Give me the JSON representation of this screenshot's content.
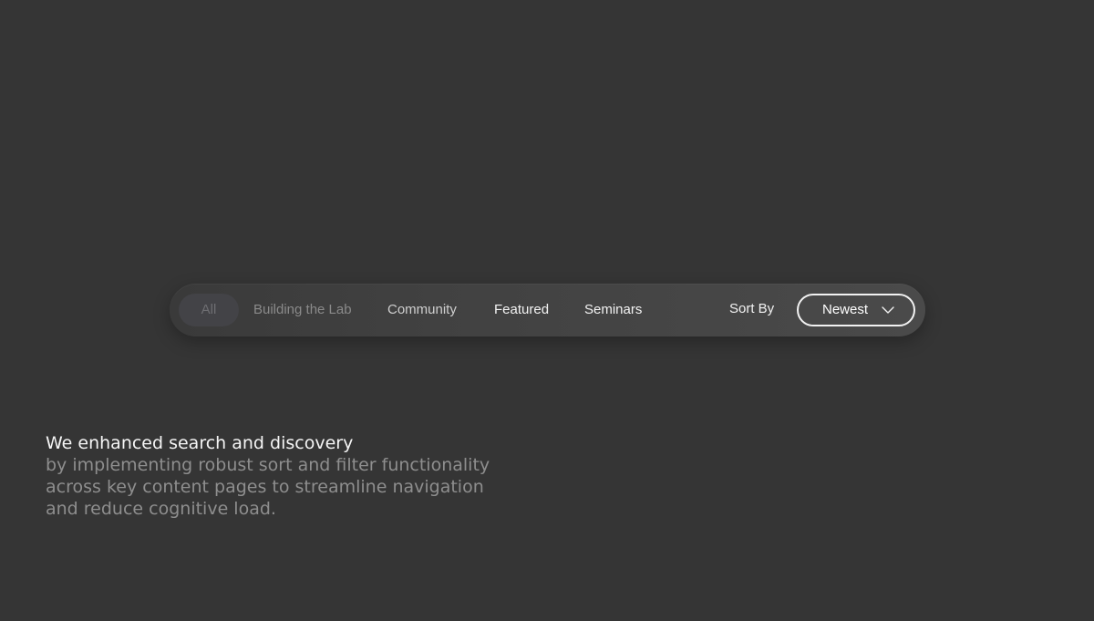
{
  "filter_bar": {
    "tabs": [
      {
        "label": "All",
        "state": "selected"
      },
      {
        "label": "Building the Lab"
      },
      {
        "label": "Community"
      },
      {
        "label": "Featured"
      },
      {
        "label": "Seminars"
      }
    ],
    "sort": {
      "label": "Sort By",
      "selected": "Newest",
      "icon": "chevron-down-icon"
    }
  },
  "caption": {
    "headline": "We enhanced search and discovery",
    "body": "by implementing robust sort and filter functionality\nacross key content pages to streamline navigation\nand reduce cognitive load."
  },
  "colors": {
    "background": "#353535",
    "bar": "#444444",
    "text_primary": "#f2f2f2",
    "text_muted": "#8e8e8e"
  }
}
